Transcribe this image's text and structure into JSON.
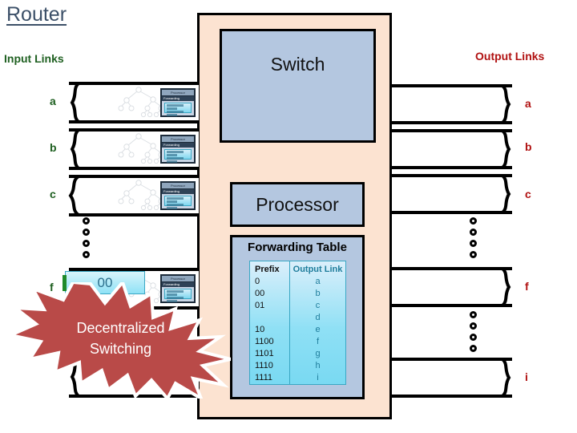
{
  "page": {
    "title": "Router"
  },
  "labels": {
    "input_links": "Input Links",
    "output_links": "Output Links"
  },
  "router": {
    "switch": "Switch",
    "processor": "Processor",
    "forwarding_table_title": "Forwarding Table"
  },
  "forwarding_table": {
    "headers": [
      "Prefix",
      "Output Link"
    ],
    "rows": [
      {
        "prefix": "0",
        "link": "a"
      },
      {
        "prefix": "00",
        "link": "b"
      },
      {
        "prefix": "01",
        "link": "c"
      },
      {
        "prefix": "",
        "link": "d"
      },
      {
        "prefix": "10",
        "link": "e"
      },
      {
        "prefix": "1100",
        "link": "f"
      },
      {
        "prefix": "1101",
        "link": "g"
      },
      {
        "prefix": "1110",
        "link": "h"
      },
      {
        "prefix": "1111",
        "link": "i"
      }
    ]
  },
  "input_links": [
    {
      "label": "a"
    },
    {
      "label": "b"
    },
    {
      "label": "c"
    },
    {
      "label": "f"
    },
    {
      "label": ""
    }
  ],
  "output_links": [
    {
      "label": "a"
    },
    {
      "label": "b"
    },
    {
      "label": "c"
    },
    {
      "label": "f"
    },
    {
      "label": "i"
    }
  ],
  "annotation": {
    "packet_tag": "00",
    "callout_line1": "Decentralized",
    "callout_line2": "Switching"
  },
  "mini_host": {
    "window_title": "Processor",
    "window_header": "Forwarding"
  },
  "colors": {
    "title": "#3c5068",
    "input_label": "#1f6021",
    "output_label": "#b11212",
    "chassis": "#fce3d1",
    "box": "#b4c7e0",
    "table_cyan": "#8fe0f5",
    "table_text": "#1f7d9c",
    "burst": "#b94a48",
    "tag": "#8fe2f6"
  }
}
